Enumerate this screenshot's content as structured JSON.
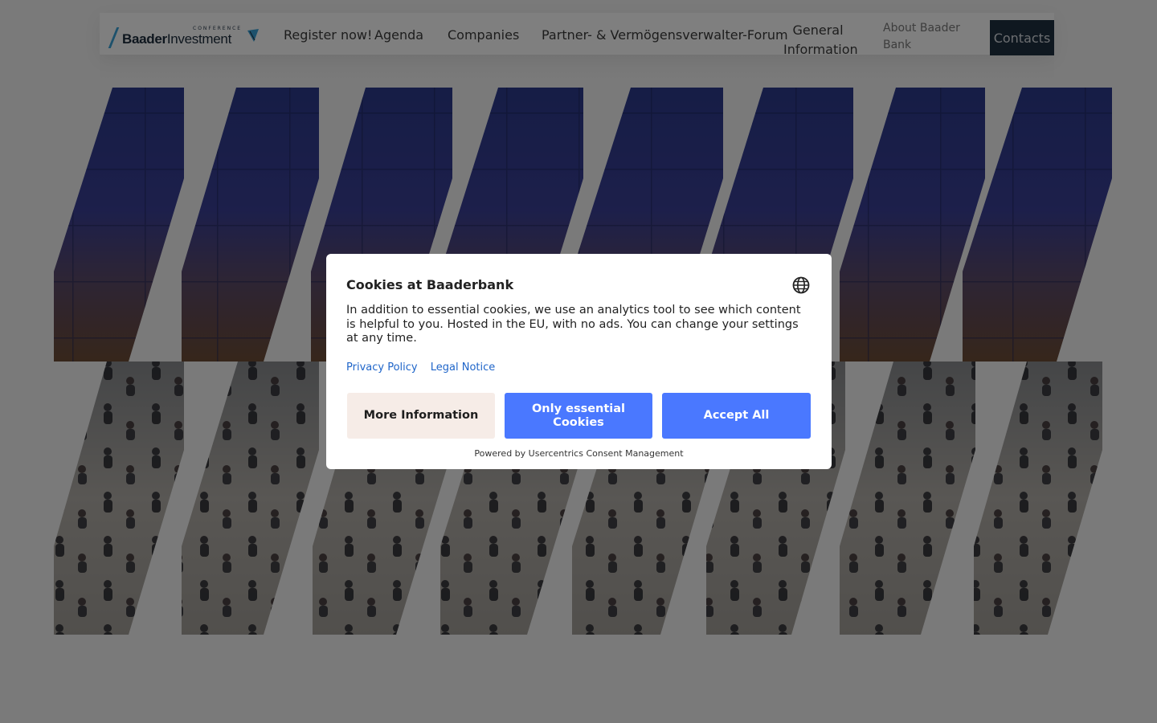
{
  "header": {
    "logo": {
      "conference": "CONFERENCE",
      "name_bold": "Baader",
      "name_light": "Investment"
    },
    "nav": [
      {
        "label": "Register now!"
      },
      {
        "label": "Agenda"
      },
      {
        "label": "Companies"
      },
      {
        "label": "Partner- & Vermögensverwalter-Forum"
      },
      {
        "label_line1": "General",
        "label_line2": "Information"
      },
      {
        "label": "About Baader Bank"
      }
    ],
    "contacts_label": "Contacts"
  },
  "cookie_dialog": {
    "title": "Cookies at Baaderbank",
    "body": "In addition to essential cookies, we use an analytics tool to see which content is helpful to you. Hosted in the EU, with no ads. You can change your settings at any time.",
    "links": {
      "privacy": "Privacy Policy",
      "legal": "Legal Notice"
    },
    "buttons": {
      "more": "More Information",
      "essential": "Only essential Cookies",
      "accept": "Accept All"
    },
    "powered_by": "Powered by Usercentrics Consent Management",
    "language_icon": "globe-icon"
  },
  "colors": {
    "accent_blue": "#4a78ff",
    "contacts_bg": "#1e3041",
    "secondary_button_bg": "#f6ece7",
    "link": "#1f65c9"
  }
}
